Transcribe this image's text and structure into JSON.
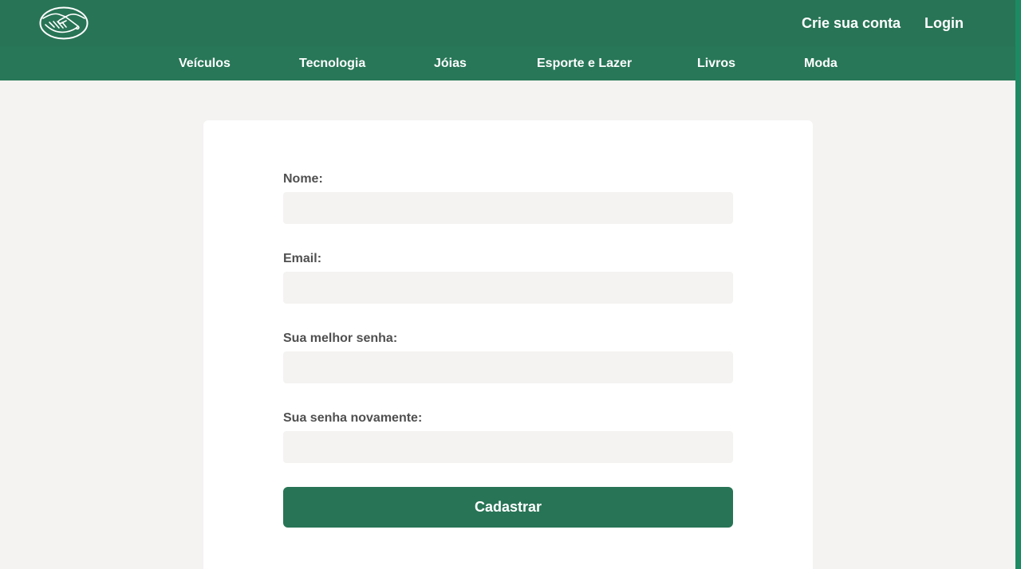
{
  "header": {
    "logo_icon": "handshake-logo-icon",
    "create_account": "Crie sua conta",
    "login": "Login"
  },
  "nav": {
    "items": [
      "Veículos",
      "Tecnologia",
      "Jóias",
      "Esporte e Lazer",
      "Livros",
      "Moda"
    ]
  },
  "form": {
    "fields": [
      {
        "label": "Nome:",
        "value": "",
        "placeholder": ""
      },
      {
        "label": "Email:",
        "value": "",
        "placeholder": ""
      },
      {
        "label": "Sua melhor senha:",
        "value": "",
        "placeholder": ""
      },
      {
        "label": "Sua senha novamente:",
        "value": "",
        "placeholder": ""
      }
    ],
    "submit_label": "Cadastrar"
  },
  "colors": {
    "brand_green": "#287456",
    "page_background": "#f4f3f1",
    "card_background": "#ffffff",
    "label_text": "#505050"
  }
}
